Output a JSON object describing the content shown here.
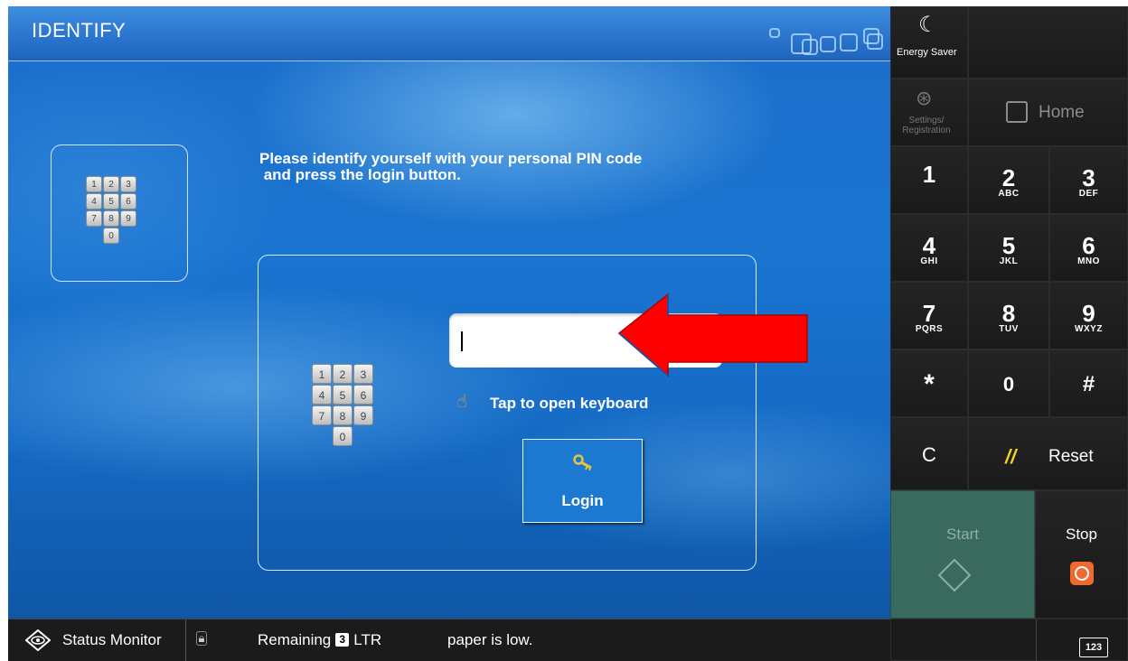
{
  "window": {
    "title": "IDENTIFY"
  },
  "main": {
    "instruction_line1": "Please identify yourself with your personal PIN code",
    "instruction_line2": " and press the login button.",
    "pin_input_value": "",
    "tap_hint": "Tap to open keyboard",
    "login_label": "Login",
    "keypad_digits": [
      "1",
      "2",
      "3",
      "4",
      "5",
      "6",
      "7",
      "8",
      "9",
      "0"
    ]
  },
  "statusbar": {
    "status_monitor_label": "Status Monitor",
    "remaining_label": "Remaining",
    "remaining_count": "3",
    "paper_size": "LTR",
    "paper_message": "paper is low."
  },
  "rightpanel": {
    "energy_saver": "Energy Saver",
    "settings_line1": "Settings/",
    "settings_line2": "Registration",
    "home": "Home",
    "keys": [
      {
        "num": "1",
        "sub": ""
      },
      {
        "num": "2",
        "sub": "ABC"
      },
      {
        "num": "3",
        "sub": "DEF"
      },
      {
        "num": "4",
        "sub": "GHI"
      },
      {
        "num": "5",
        "sub": "JKL"
      },
      {
        "num": "6",
        "sub": "MNO"
      },
      {
        "num": "7",
        "sub": "PQRS"
      },
      {
        "num": "8",
        "sub": "TUV"
      },
      {
        "num": "9",
        "sub": "WXYZ"
      },
      {
        "num": "*",
        "sub": ""
      },
      {
        "num": "0",
        "sub": ""
      },
      {
        "num": "#",
        "sub": ""
      }
    ],
    "clear": "C",
    "reset": "Reset",
    "start": "Start",
    "stop": "Stop",
    "keyboard_icon_text": "123"
  },
  "colors": {
    "screen_blue": "#1c6fcb",
    "arrow_red": "#ff0000",
    "start_green": "#3a6a5d",
    "stop_orange": "#f06a30",
    "reset_yellow": "#f0d21e"
  },
  "icons": [
    "grid-squares-icon",
    "keypad-icon",
    "pointing-hand-icon",
    "key-icon",
    "status-monitor-icon",
    "lock-icon",
    "moon-icon",
    "settings-icon",
    "home-icon",
    "start-icon",
    "stop-icon",
    "keyboard-icon"
  ]
}
